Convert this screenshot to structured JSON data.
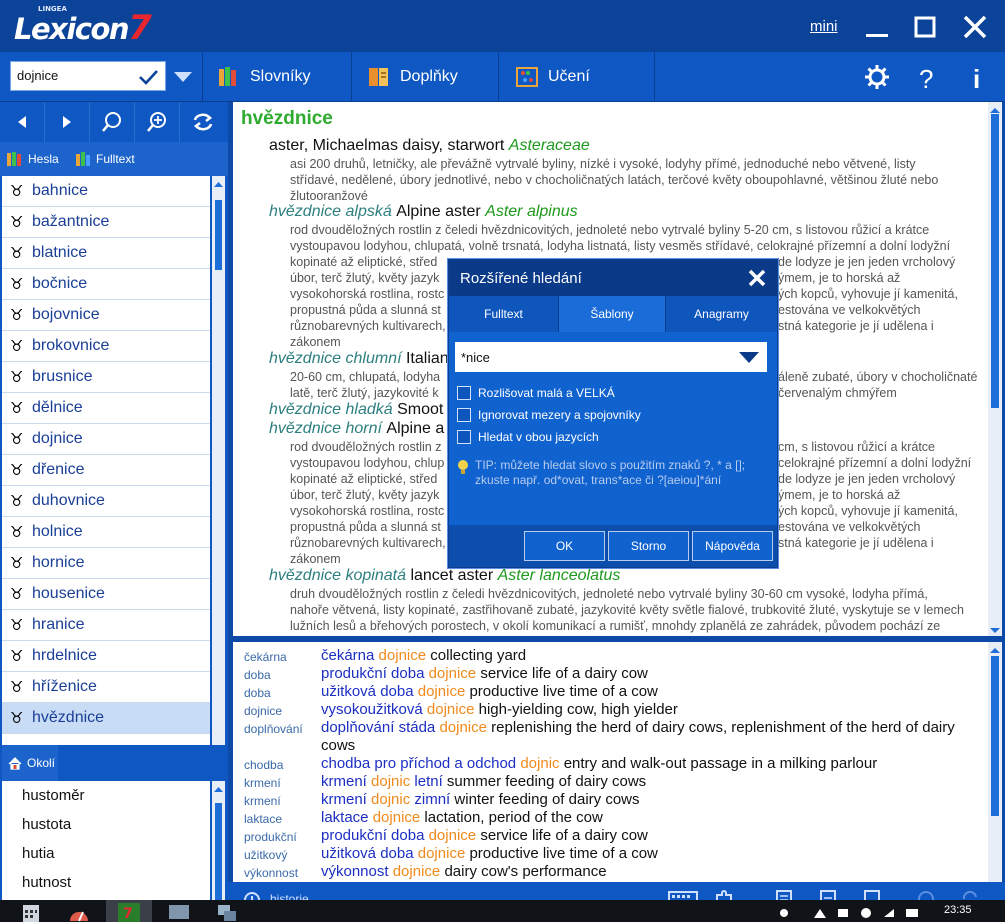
{
  "app": {
    "logo_text": "Lexicon",
    "logo_number": "7",
    "logo_brand": "LINGEA",
    "mini_label": "mini"
  },
  "toolbar": {
    "search_value": "dojnice",
    "menu": [
      "Slovníky",
      "Doplňky",
      "Učení"
    ]
  },
  "left": {
    "tabs": [
      "Hesla",
      "Fulltext"
    ],
    "words": [
      "bahnice",
      "bažantnice",
      "blatnice",
      "bočnice",
      "bojovnice",
      "brokovnice",
      "brusnice",
      "dělnice",
      "dojnice",
      "dřenice",
      "duhovnice",
      "holnice",
      "hornice",
      "housenice",
      "hranice",
      "hrdelnice",
      "hříženice",
      "hvězdnice"
    ],
    "selected_index": 17,
    "okoli_label": "Okolí",
    "okoli_items": [
      "hustoměr",
      "hustota",
      "hutia",
      "hutnost"
    ]
  },
  "entry": {
    "headword": "hvězdnice",
    "main_translation": "aster, Michaelmas daisy, starwort",
    "main_latin": "Asteraceae",
    "main_def": [
      "asi 200 druhů, letničky, ale převážně vytrvalé byliny, nízké i vysoké, lodyhy přímé, jednoduché nebo větvené, listy",
      "střídavé, nedělené, úbory jednotlivé, nebo v chocholičnatých latách, terčové květy oboupohlavné, většinou žluté nebo",
      "žlutooranžové"
    ],
    "sub1": {
      "term": "hvězdnice alpská",
      "tr": "Alpine aster",
      "latin": "Aster alpinus"
    },
    "sub1_def": [
      "rod dvouděložných rostlin z čeledi hvězdnicovitých, jednoleté nebo vytrvalé byliny 5-20 cm, s listovou růžicí a krátce",
      "vystoupavou lodyhou, chlupatá, volně trsnatá, lodyha listnatá, listy vesměs střídavé, celokrajné přízemní a dolní lodyžní",
      "kopinaté až eliptické, střed",
      "úbor, terč žlutý, květy jazyk",
      "vysokohorská rostlina, rostc",
      "propustná půda a slunná st",
      "různobarevných kultivarech,",
      "zákonem"
    ],
    "sub1_def_right": [
      "de lodyze je jen jeden vrcholový",
      "ýmem, je to horská až",
      "ých kopců, vyhovuje jí kamenitá,",
      "estována ve velkokvětých",
      "stná kategorie je jí udělena i"
    ],
    "sub2": {
      "term": "hvězdnice chlumní",
      "tr": "Italian"
    },
    "sub2_def": [
      "20-60 cm, chlupatá, lodyha",
      "latě, terč žlutý, jazykovité k"
    ],
    "sub2_def_right": [
      "áleně zubaté, úbory v chocholičnaté",
      "červenalým chmýřem"
    ],
    "sub3": {
      "term": "hvězdnice hladká",
      "tr": "Smoot"
    },
    "sub4": {
      "term": "hvězdnice horní",
      "tr": "Alpine a"
    },
    "sub4_def": [
      "rod dvouděložných rostlin z",
      "vystoupavou lodyhou, chlup",
      "kopinaté až eliptické, střed",
      "úbor, terč žlutý, květy jazyk",
      "vysokohorská rostlina, rostc",
      "propustná půda a slunná st",
      "různobarevných kultivarech,",
      "zákonem"
    ],
    "sub4_def_right": [
      "cm, s listovou růžicí a krátce",
      "celokrajné přízemní a dolní lodyžní",
      "de lodyze je jen jeden vrcholový",
      "ýmem, je to horská až",
      "ých kopců, vyhovuje jí kamenitá,",
      "estována ve velkokvětých",
      "stná kategorie je jí udělena i"
    ],
    "sub5": {
      "term": "hvězdnice kopinatá",
      "tr": "lancet aster",
      "latin": "Aster lanceolatus"
    },
    "sub5_def": [
      "druh dvouděložných rostlin z čeledi hvězdnicovitých, jednoleté nebo vytrvalé byliny 30-60 cm vysoké, lodyha přímá,",
      "nahoře větvená, listy kopinaté, zastřihovaně zubaté, jazykovité květy světle fialové, trubkovité žluté, vyskytuje se v lemech",
      "lužních lesů a břehových porostech, v okolí komunikací a rumišť, mnohdy zplanělá ze zahrádek, původem pochází ze"
    ]
  },
  "bottom": {
    "rows": [
      {
        "key": "čekárna",
        "cz1": "čekárna",
        "hl": "dojnice",
        "cz2": "",
        "en": "collecting yard"
      },
      {
        "key": "doba",
        "cz1": "produkční doba",
        "hl": "dojnice",
        "cz2": "",
        "en": "service life of a dairy cow"
      },
      {
        "key": "doba",
        "cz1": "užitková doba",
        "hl": "dojnice",
        "cz2": "",
        "en": "productive live time of a cow"
      },
      {
        "key": "dojnice",
        "cz1": "vysokoužitková",
        "hl": "dojnice",
        "cz2": "",
        "en": "high-yielding cow, high yielder"
      },
      {
        "key": "doplňování",
        "cz1": "doplňování stáda",
        "hl": "dojnice",
        "cz2": "",
        "en": "replenishing the herd of dairy cows, replenishment of the herd of dairy"
      },
      {
        "key": "",
        "cz1": "",
        "hl": "",
        "cz2": "",
        "en": "cows"
      },
      {
        "key": "chodba",
        "cz1": "chodba pro příchod a odchod",
        "hl": "dojnic",
        "cz2": "",
        "en": "entry and walk-out passage in a milking parlour"
      },
      {
        "key": "krmení",
        "cz1": "krmení",
        "hl": "dojnic",
        "cz2": "letní",
        "en": "summer feeding of dairy cows"
      },
      {
        "key": "krmení",
        "cz1": "krmení",
        "hl": "dojnic",
        "cz2": "zimní",
        "en": "winter feeding of dairy cows"
      },
      {
        "key": "laktace",
        "cz1": "laktace",
        "hl": "dojnice",
        "cz2": "",
        "en": "lactation, period of the cow"
      },
      {
        "key": "produkční",
        "cz1": "produkční doba",
        "hl": "dojnice",
        "cz2": "",
        "en": "service life of a dairy cow"
      },
      {
        "key": "užitkový",
        "cz1": "užitková doba",
        "hl": "dojnice",
        "cz2": "",
        "en": "productive live time of a cow"
      },
      {
        "key": "výkonnost",
        "cz1": "výkonnost",
        "hl": "dojnice",
        "cz2": "",
        "en": "dairy cow's performance"
      }
    ]
  },
  "status": {
    "history_label": "historie",
    "clock": "23:35"
  },
  "dialog": {
    "title": "Rozšířené hledání",
    "tabs": [
      "Fulltext",
      "Šablony",
      "Anagramy"
    ],
    "input_value": "*nice",
    "checkboxes": [
      "Rozlišovat malá a VELKÁ",
      "Ignorovat mezery a spojovníky",
      "Hledat v obou jazycích"
    ],
    "tip": "TIP: můžete hledat slovo s použitím znaků ?, * a []; zkuste např. od*ovat, trans*ace či ?[aeiou]*ání",
    "buttons": [
      "OK",
      "Storno",
      "Nápověda"
    ]
  }
}
